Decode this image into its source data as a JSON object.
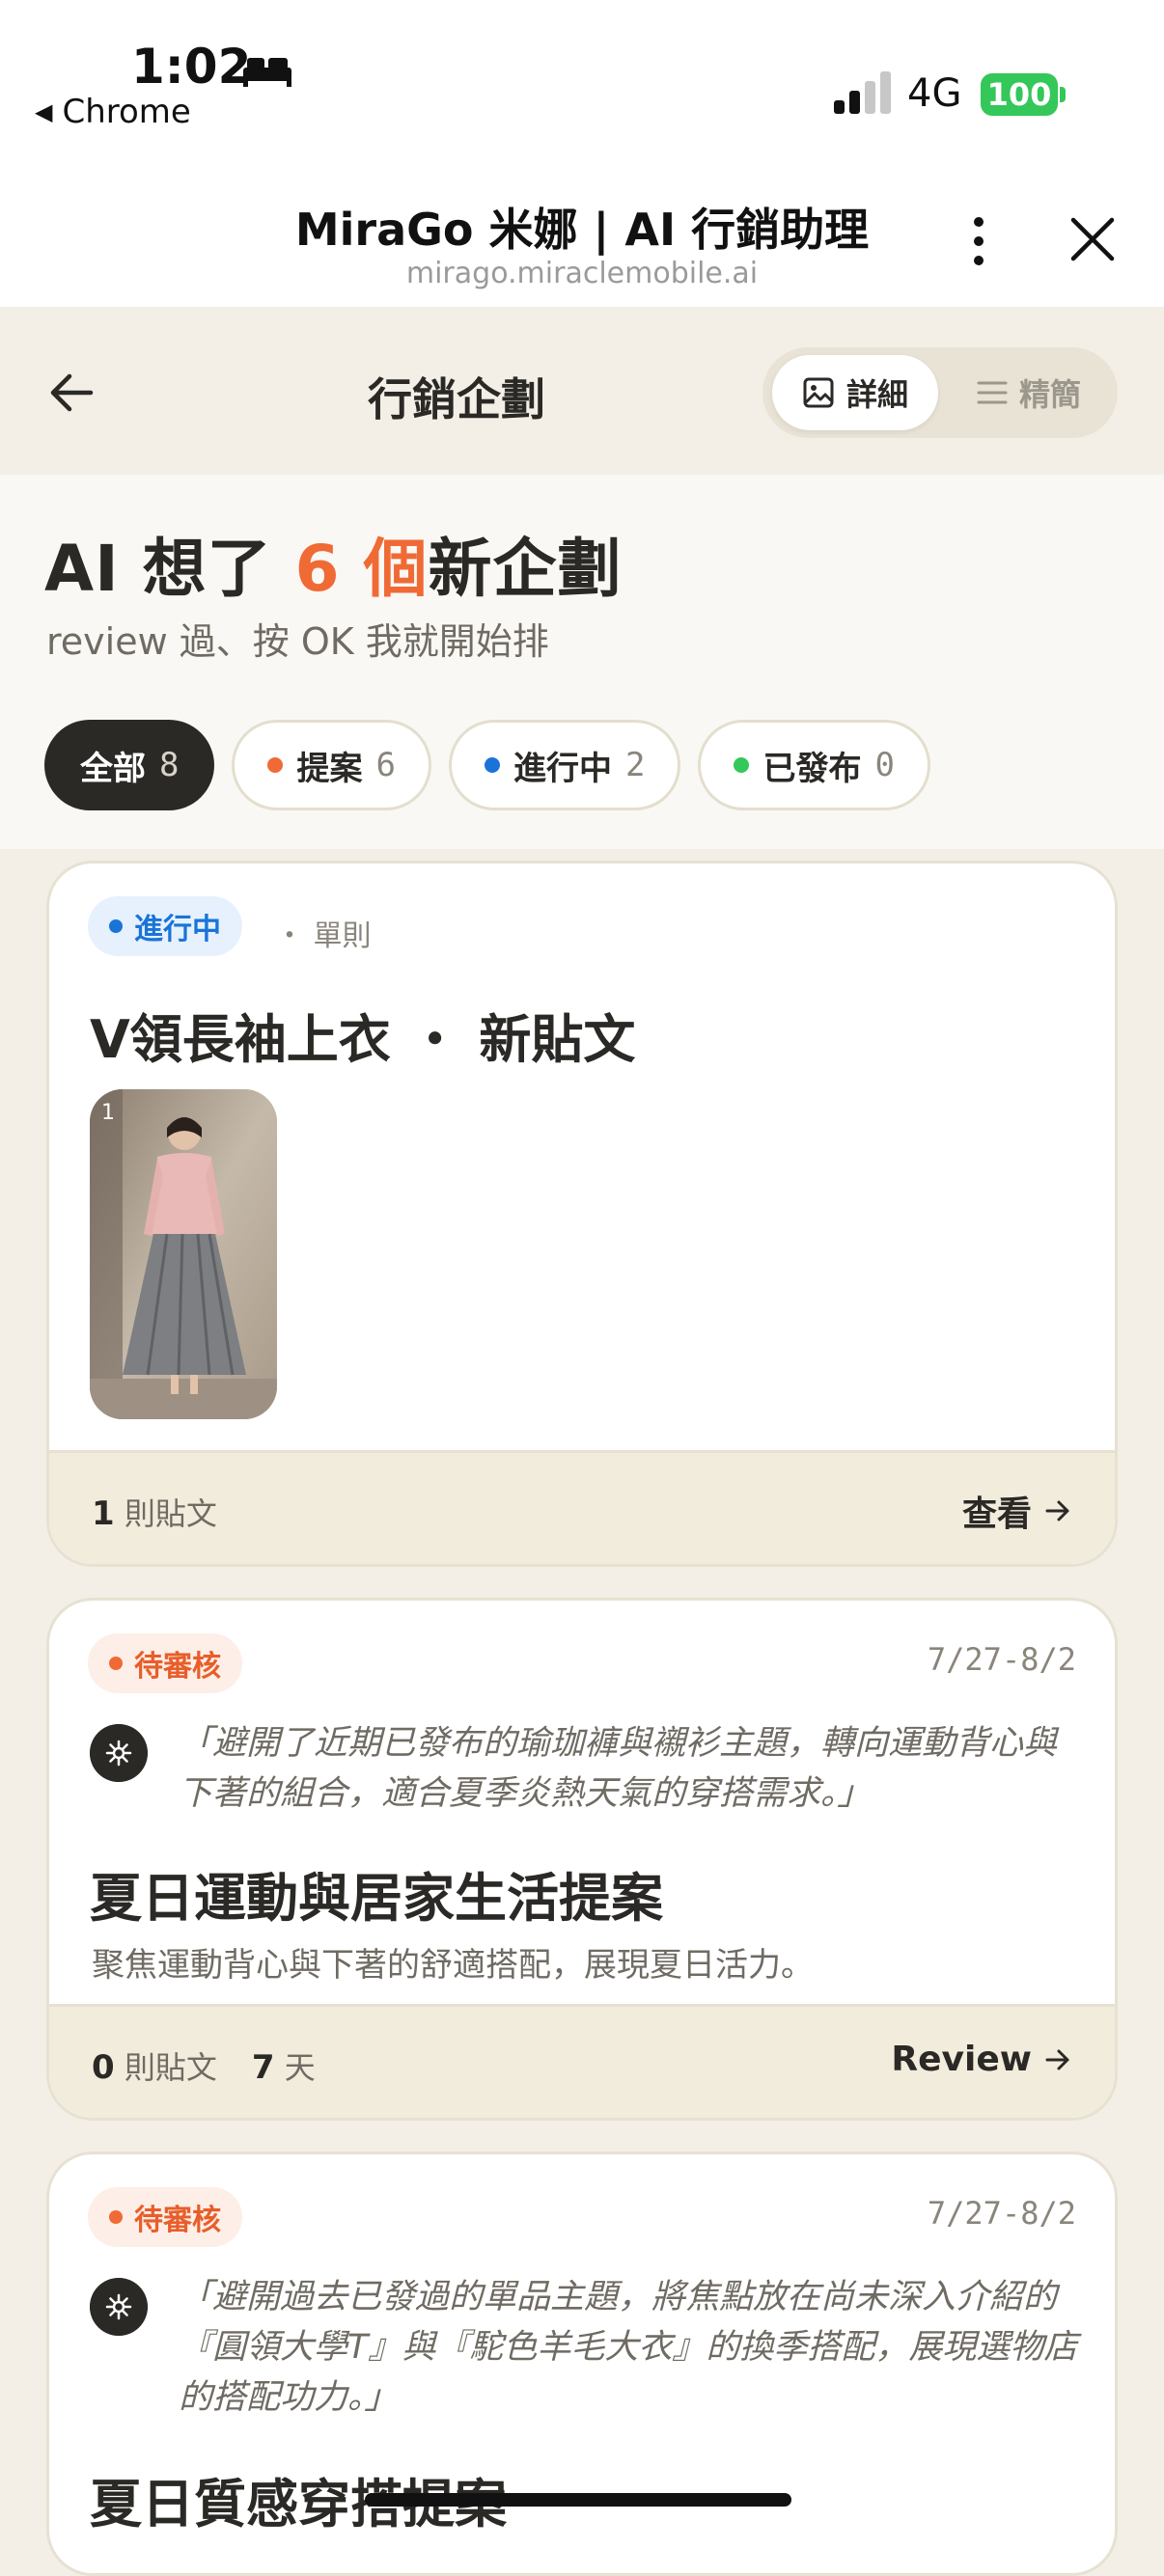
{
  "status_bar": {
    "time": "1:02",
    "back_app": "Chrome",
    "network": "4G",
    "battery": "100"
  },
  "browser": {
    "title": "MiraGo 米娜 | AI 行銷助理",
    "url": "mirago.miraclemobile.ai"
  },
  "header": {
    "title": "行銷企劃",
    "view_toggle": {
      "detail": "詳細",
      "compact": "精簡"
    }
  },
  "hero": {
    "title_prefix": "AI 想了 ",
    "title_count": "6 個",
    "title_suffix": "新企劃",
    "subtitle": "review 過、按 OK 我就開始排"
  },
  "filters": [
    {
      "label": "全部",
      "count": "8",
      "dot": ""
    },
    {
      "label": "提案",
      "count": "6",
      "dot": "#f06a35"
    },
    {
      "label": "進行中",
      "count": "2",
      "dot": "#1a74d8"
    },
    {
      "label": "已發布",
      "count": "0",
      "dot": "#34c759"
    }
  ],
  "cards": [
    {
      "status": "進行中",
      "meta": "單則",
      "title": "V領長袖上衣 ・ 新貼文",
      "thumb_index": "1",
      "posts_count": "1",
      "posts_label": "則貼文",
      "action": "查看"
    },
    {
      "status": "待審核",
      "date": "7/27-8/2",
      "reason": "「避開了近期已發布的瑜珈褲與襯衫主題，轉向運動背心與下著的組合，適合夏季炎熱天氣的穿搭需求。」",
      "title": "夏日運動與居家生活提案",
      "description": "聚焦運動背心與下著的舒適搭配，展現夏日活力。",
      "posts_count": "0",
      "posts_label": "則貼文",
      "days_count": "7",
      "days_label": "天",
      "action": "Review"
    },
    {
      "status": "待審核",
      "date": "7/27-8/2",
      "reason": "「避開過去已發過的單品主題，將焦點放在尚未深入介紹的『圓領大學T』與『駝色羊毛大衣』的換季搭配，展現選物店的搭配功力。」",
      "title": "夏日質感穿搭提案"
    }
  ],
  "colors": {
    "accent": "#f06a35",
    "blue": "#1a74d8",
    "green": "#34c759",
    "background": "#f3efe6"
  }
}
